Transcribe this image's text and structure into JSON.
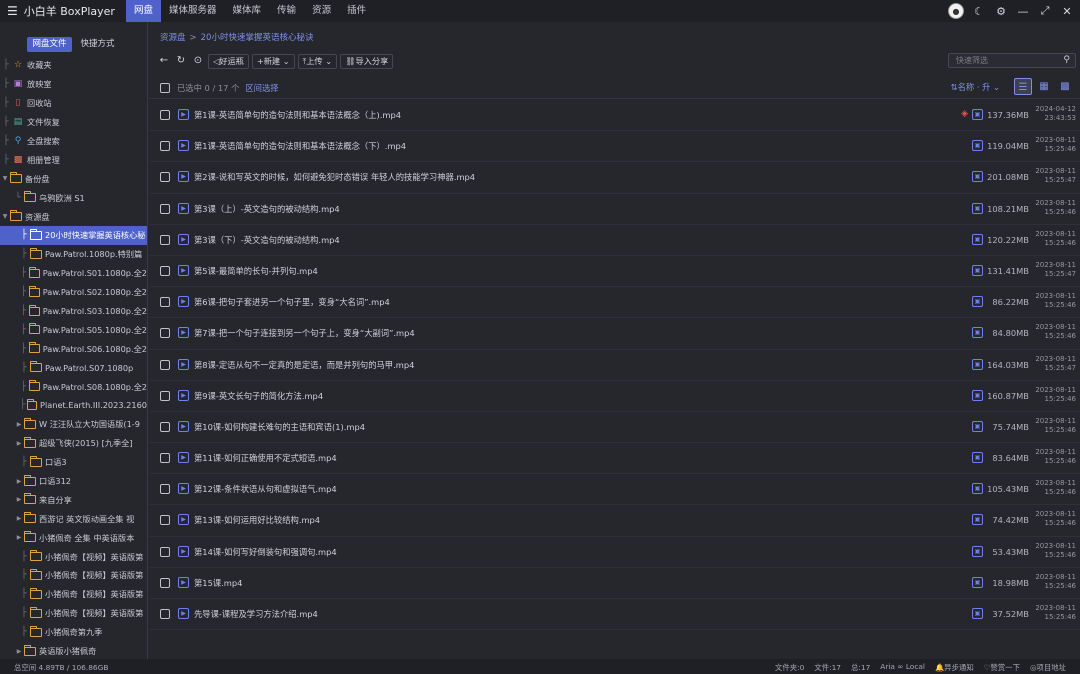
{
  "app": {
    "title": "小白羊 BoxPlayer",
    "menu_icon": "menu-icon"
  },
  "nav": [
    {
      "label": "网盘",
      "active": true
    },
    {
      "label": "媒体服务器"
    },
    {
      "label": "媒体库"
    },
    {
      "label": "传输"
    },
    {
      "label": "资源"
    },
    {
      "label": "插件"
    }
  ],
  "sidebar": {
    "tabs": [
      {
        "label": "网盘文件",
        "active": true
      },
      {
        "label": "快捷方式"
      }
    ],
    "tree": [
      {
        "label": "收藏夹",
        "icon": "star-icon",
        "color": "#e0a33a"
      },
      {
        "label": "放映室",
        "icon": "tv-icon",
        "color": "#b57be0"
      },
      {
        "label": "回收站",
        "icon": "trash-icon",
        "color": "#e35a4c"
      },
      {
        "label": "文件恢复",
        "icon": "restore-icon",
        "color": "#4fb39a"
      },
      {
        "label": "全盘搜索",
        "icon": "search-icon",
        "color": "#4a9de8"
      },
      {
        "label": "相册管理",
        "icon": "album-icon",
        "color": "#e07a5a"
      },
      {
        "label": "备份盘",
        "expanded": true
      },
      {
        "label": "乌鸦欧洲 S1",
        "level": 1
      },
      {
        "label": "资源盘",
        "expanded": true
      },
      {
        "label": "20小时快速掌握英语核心秘",
        "level": 1,
        "selected": true
      },
      {
        "label": "Paw.Patrol.1080p.特别篇",
        "level": 1
      },
      {
        "label": "Paw.Patrol.S01.1080p.全2",
        "level": 1
      },
      {
        "label": "Paw.Patrol.S02.1080p.全2",
        "level": 1
      },
      {
        "label": "Paw.Patrol.S03.1080p.全2",
        "level": 1
      },
      {
        "label": "Paw.Patrol.S05.1080p.全2",
        "level": 1
      },
      {
        "label": "Paw.Patrol.S06.1080p.全2",
        "level": 1
      },
      {
        "label": "Paw.Patrol.S07.1080p",
        "level": 1
      },
      {
        "label": "Paw.Patrol.S08.1080p.全2",
        "level": 1
      },
      {
        "label": "Planet.Earth.III.2023.2160",
        "level": 1
      },
      {
        "label": "W 汪汪队立大功国语版(1-9",
        "level": 1,
        "collapsed": true
      },
      {
        "label": "超级飞侠(2015) [九季全]",
        "level": 1,
        "collapsed": true
      },
      {
        "label": "口语3",
        "level": 1
      },
      {
        "label": "口语312",
        "level": 1,
        "collapsed": true
      },
      {
        "label": "来自分享",
        "level": 1,
        "collapsed": true
      },
      {
        "label": "西游记 英文版动画全集 视",
        "level": 1,
        "collapsed": true
      },
      {
        "label": "小猪佩奇 全集 中英语版本",
        "level": 1,
        "collapsed": true
      },
      {
        "label": "小猪佩奇【视频】英语版第",
        "level": 1
      },
      {
        "label": "小猪佩奇【视频】英语版第",
        "level": 1
      },
      {
        "label": "小猪佩奇【视频】英语版第",
        "level": 1
      },
      {
        "label": "小猪佩奇【视频】英语版第",
        "level": 1
      },
      {
        "label": "小猪佩奇第九季",
        "level": 1
      },
      {
        "label": "英语版小猪佩奇",
        "level": 1,
        "collapsed": true
      }
    ]
  },
  "breadcrumb": [
    "资源盘",
    "20小时快速掌握英语核心秘诀"
  ],
  "toolbar": {
    "haoyundian": "好运瓶",
    "new": "+新建",
    "upload": "上传",
    "import_share": "导入分享"
  },
  "search": {
    "placeholder": "快速筛选"
  },
  "list": {
    "selected_text": "已选中 0 / 17 个",
    "range_select": "区间选择",
    "sort_label": "名称 · 升",
    "rows": [
      {
        "name": "第1课-英语简单句的造句法则和基本语法概念（上).mp4",
        "size": "137.36MB",
        "date": "2024-04-12",
        "time": "23:43:53",
        "tag": true
      },
      {
        "name": "第1课-英语简单句的造句法则和基本语法概念（下）.mp4",
        "size": "119.04MB",
        "date": "2023-08-11",
        "time": "15:25:46"
      },
      {
        "name": "第2课-说和写英文的时候，如何避免犯时态错误  年轻人的技能学习神器.mp4",
        "size": "201.08MB",
        "date": "2023-08-11",
        "time": "15:25:47"
      },
      {
        "name": "第3课（上）-英文造句的被动结构.mp4",
        "size": "108.21MB",
        "date": "2023-08-11",
        "time": "15:25:46"
      },
      {
        "name": "第3课（下）-英文造句的被动结构.mp4",
        "size": "120.22MB",
        "date": "2023-08-11",
        "time": "15:25:46"
      },
      {
        "name": "第5课-最简单的长句-并列句.mp4",
        "size": "131.41MB",
        "date": "2023-08-11",
        "time": "15:25:47"
      },
      {
        "name": "第6课-把句子套进另一个句子里，变身“大名词”.mp4",
        "size": "86.22MB",
        "date": "2023-08-11",
        "time": "15:25:46"
      },
      {
        "name": "第7课-把一个句子连接到另一个句子上，变身“大副词”.mp4",
        "size": "84.80MB",
        "date": "2023-08-11",
        "time": "15:25:46"
      },
      {
        "name": "第8课-定语从句不一定真的是定语，而是并列句的马甲.mp4",
        "size": "164.03MB",
        "date": "2023-08-11",
        "time": "15:25:47"
      },
      {
        "name": "第9课-英文长句子的简化方法.mp4",
        "size": "160.87MB",
        "date": "2023-08-11",
        "time": "15:25:46"
      },
      {
        "name": "第10课-如何构建长难句的主语和宾语(1).mp4",
        "size": "75.74MB",
        "date": "2023-08-11",
        "time": "15:25:46"
      },
      {
        "name": "第11课-如何正确使用不定式短语.mp4",
        "size": "83.64MB",
        "date": "2023-08-11",
        "time": "15:25:46"
      },
      {
        "name": "第12课-条件状语从句和虚拟语气.mp4",
        "size": "105.43MB",
        "date": "2023-08-11",
        "time": "15:25:46"
      },
      {
        "name": "第13课-如何运用好比较结构.mp4",
        "size": "74.42MB",
        "date": "2023-08-11",
        "time": "15:25:46"
      },
      {
        "name": "第14课-如何写好倒装句和强调句.mp4",
        "size": "53.43MB",
        "date": "2023-08-11",
        "time": "15:25:46"
      },
      {
        "name": "第15课.mp4",
        "size": "18.98MB",
        "date": "2023-08-11",
        "time": "15:25:46"
      },
      {
        "name": "先导课-课程及学习方法介绍.mp4",
        "size": "37.52MB",
        "date": "2023-08-11",
        "time": "15:25:46"
      }
    ]
  },
  "status": {
    "space": "总空间 4.89TB / 106.86GB",
    "folders": "文件夹:0",
    "files": "文件:17",
    "total": "总:17",
    "aria": "Aria ∞ Local",
    "notify": "异步通知",
    "appreciate": "赞赏一下",
    "project": "项目地址"
  }
}
